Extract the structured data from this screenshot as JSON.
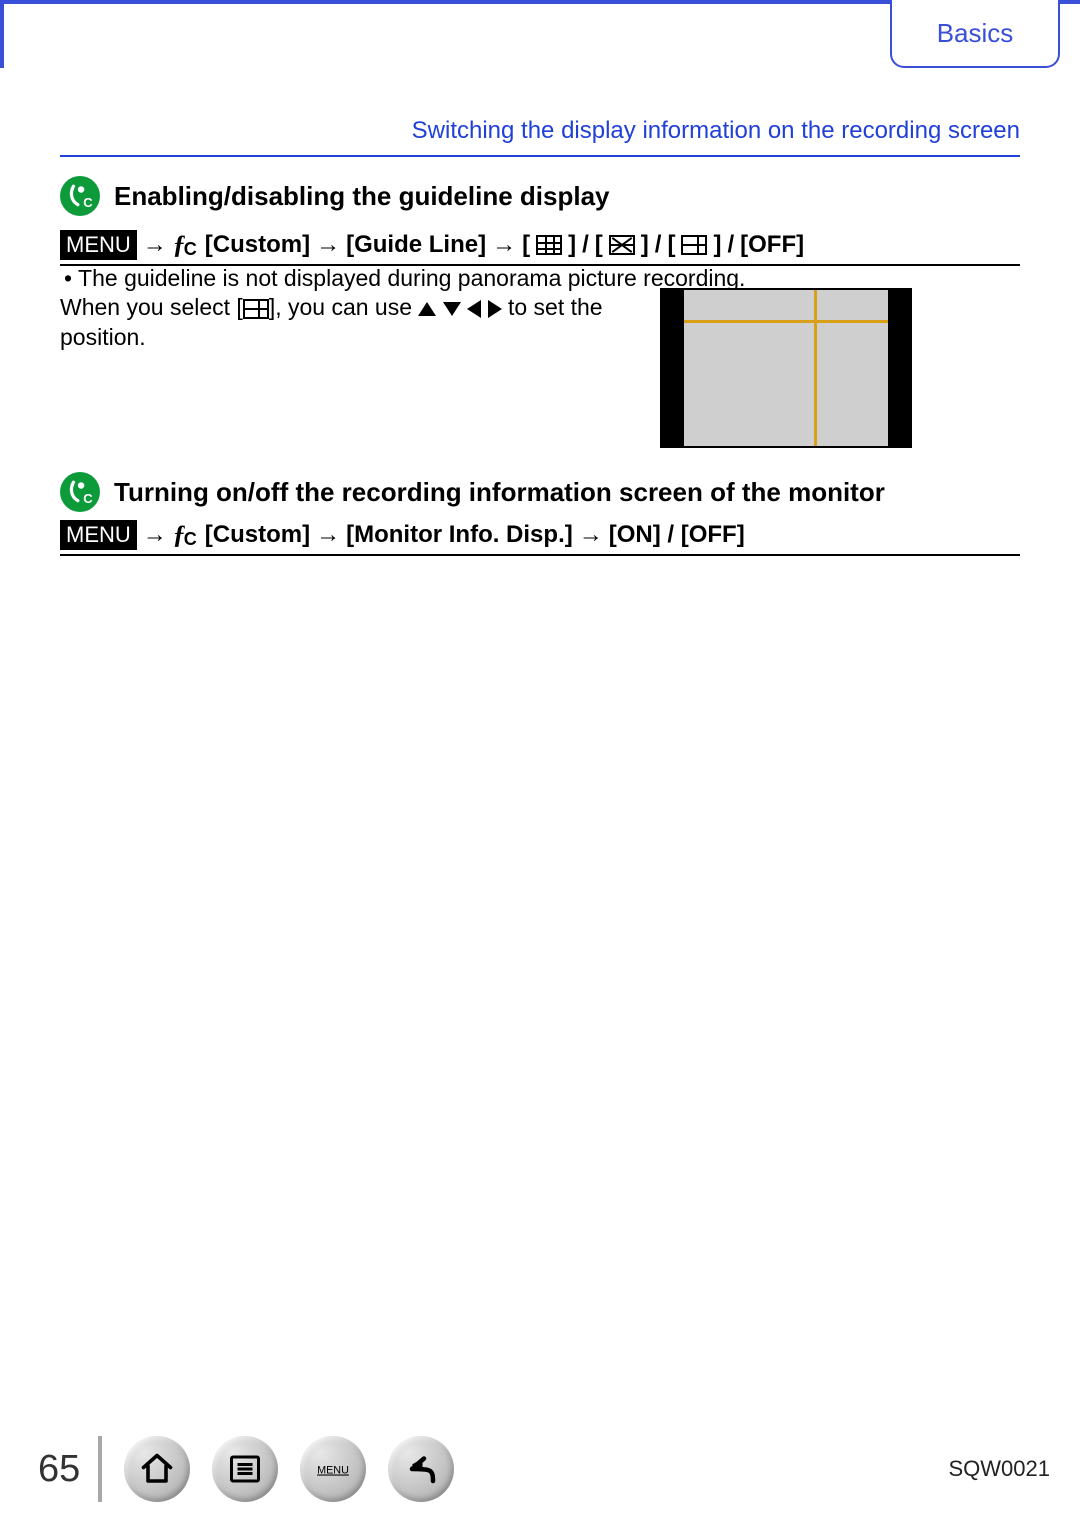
{
  "header": {
    "category": "Basics"
  },
  "subtitle": "Switching the display information on the recording screen",
  "section1": {
    "title": "Enabling/disabling the guideline display",
    "menu_label": "MENU",
    "custom_label": "[Custom]",
    "item_label": "[Guide Line]",
    "off_label": "[OFF]",
    "arrow": "→",
    "slash": " / ",
    "note_bullet": "•",
    "note": "The guideline is not displayed during panorama picture recording.",
    "body_pre": "When you select [",
    "body_mid": "], you can use ",
    "body_post": " to set the position."
  },
  "section2": {
    "title": "Turning on/off the recording information screen of the monitor",
    "menu_label": "MENU",
    "custom_label": "[Custom]",
    "item_label": "[Monitor Info. Disp.]",
    "onoff_label": "[ON] / [OFF]",
    "arrow": "→"
  },
  "footer": {
    "page": "65",
    "doc_id": "SQW0021"
  }
}
